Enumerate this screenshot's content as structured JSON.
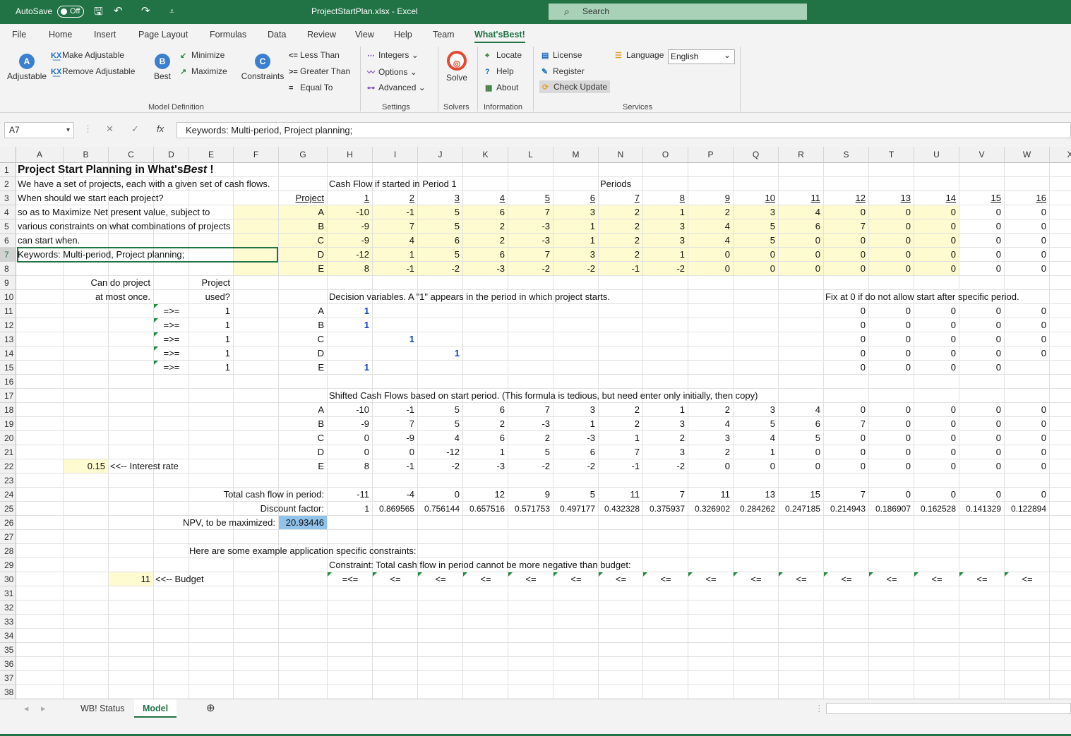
{
  "title": {
    "autosave": "AutoSave",
    "toggle": "Off",
    "file": "ProjectStartPlan.xlsx  -  Excel",
    "search": "Search"
  },
  "menu": [
    "File",
    "Home",
    "Insert",
    "Page Layout",
    "Formulas",
    "Data",
    "Review",
    "View",
    "Help",
    "Team",
    "What'sBest!"
  ],
  "ribbon": {
    "adjustable": "Adjustable",
    "make_adj": "Make Adjustable",
    "remove_adj": "Remove Adjustable",
    "best": "Best",
    "minimize": "Minimize",
    "maximize": "Maximize",
    "constraints": "Constraints",
    "less": "Less Than",
    "greater": "Greater Than",
    "equal": "Equal To",
    "integers": "Integers",
    "options": "Options",
    "advanced": "Advanced",
    "solve": "Solve",
    "locate": "Locate",
    "help": "Help",
    "about": "About",
    "license": "License",
    "register": "Register",
    "check": "Check Update",
    "language": "Language",
    "lang_val": "English",
    "g_model": "Model Definition",
    "g_settings": "Settings",
    "g_solvers": "Solvers",
    "g_info": "Information",
    "g_services": "Services"
  },
  "namebox": "A7",
  "formula": "Keywords: Multi-period, Project planning;",
  "columns": [
    "A",
    "B",
    "C",
    "D",
    "E",
    "F",
    "G",
    "H",
    "I",
    "J",
    "K",
    "L",
    "M",
    "N",
    "O",
    "P",
    "Q",
    "R",
    "S",
    "T",
    "U",
    "V",
    "W",
    "X"
  ],
  "rows": [
    "1",
    "2",
    "3",
    "4",
    "5",
    "6",
    "7",
    "8",
    "9",
    "10",
    "11",
    "12",
    "13",
    "14",
    "15",
    "16",
    "17",
    "18",
    "19",
    "20",
    "21",
    "22",
    "23",
    "24",
    "25",
    "26",
    "27",
    "28",
    "29",
    "30",
    "31",
    "32",
    "33",
    "34",
    "35",
    "36",
    "37",
    "38"
  ],
  "text": {
    "r1": "Project Start Planning in What's",
    "r1b": "Best",
    "r1c": " !",
    "r2": "We have a set of projects, each with a given set of cash flows.",
    "r3": "When should we start each project?",
    "r4": "so as to Maximize Net present value,  subject to",
    "r5": "various constraints on what combinations of projects",
    "r6": "can start when.",
    "r7": "Keywords: Multi-period, Project planning;",
    "cf_hdr": "Cash Flow if started in Period 1",
    "periods": "Periods",
    "project": "Project",
    "can_do": "Can do project",
    "at_most": "at most once.",
    "proj": "Project",
    "used": "used?",
    "dec_vars": "Decision variables.  A \"1\" appears in the period in which project starts.",
    "fix0": "Fix at 0 if do not allow start after specific period.",
    "shifted": "Shifted Cash Flows based on start period. (This formula is tedious, but need enter only initially, then copy)",
    "interest": "<<-- Interest rate",
    "interest_val": "0.15",
    "total_cf": "Total cash flow in period:",
    "discount": "Discount factor:",
    "npv": "NPV, to be maximized:",
    "npv_val": "20.93446",
    "example": "Here are some example application specific constraints:",
    "constraint": "Constraint: Total cash flow in period cannot be more negative than budget:",
    "budget_val": "11",
    "budget": "<<-- Budget"
  },
  "projects": [
    "A",
    "B",
    "C",
    "D",
    "E"
  ],
  "period_nums": [
    "1",
    "2",
    "3",
    "4",
    "5",
    "6",
    "7",
    "8",
    "9",
    "10",
    "11",
    "12",
    "13",
    "14",
    "15",
    "16"
  ],
  "cashflows": [
    [
      "-10",
      "-1",
      "5",
      "6",
      "7",
      "3",
      "2",
      "1",
      "2",
      "3",
      "4",
      "0",
      "0",
      "0",
      "0",
      "0"
    ],
    [
      "-9",
      "7",
      "5",
      "2",
      "-3",
      "1",
      "2",
      "3",
      "4",
      "5",
      "6",
      "7",
      "0",
      "0",
      "0",
      "0"
    ],
    [
      "-9",
      "4",
      "6",
      "2",
      "-3",
      "1",
      "2",
      "3",
      "4",
      "5",
      "0",
      "0",
      "0",
      "0",
      "0",
      "0"
    ],
    [
      "-12",
      "1",
      "5",
      "6",
      "7",
      "3",
      "2",
      "1",
      "0",
      "0",
      "0",
      "0",
      "0",
      "0",
      "0",
      "0"
    ],
    [
      "8",
      "-1",
      "-2",
      "-3",
      "-2",
      "-2",
      "-1",
      "-2",
      "0",
      "0",
      "0",
      "0",
      "0",
      "0",
      "0",
      "0"
    ]
  ],
  "used_op": "=>=",
  "used_vals": [
    "1",
    "1",
    "1",
    "1",
    "1"
  ],
  "decisions": [
    [
      "1"
    ],
    [
      "1"
    ],
    [
      "",
      "1"
    ],
    [
      "",
      "",
      "1"
    ],
    [
      "1"
    ]
  ],
  "fix_vals": [
    [
      "0",
      "0",
      "0",
      "0",
      "0"
    ],
    [
      "0",
      "0",
      "0",
      "0",
      "0"
    ],
    [
      "0",
      "0",
      "0",
      "0",
      "0"
    ],
    [
      "0",
      "0",
      "0",
      "0",
      "0"
    ],
    [
      "0",
      "0",
      "0",
      "0"
    ]
  ],
  "shifted": [
    [
      "-10",
      "-1",
      "5",
      "6",
      "7",
      "3",
      "2",
      "1",
      "2",
      "3",
      "4",
      "0",
      "0",
      "0",
      "0",
      "0"
    ],
    [
      "-9",
      "7",
      "5",
      "2",
      "-3",
      "1",
      "2",
      "3",
      "4",
      "5",
      "6",
      "7",
      "0",
      "0",
      "0",
      "0"
    ],
    [
      "0",
      "-9",
      "4",
      "6",
      "2",
      "-3",
      "1",
      "2",
      "3",
      "4",
      "5",
      "0",
      "0",
      "0",
      "0",
      "0"
    ],
    [
      "0",
      "0",
      "-12",
      "1",
      "5",
      "6",
      "7",
      "3",
      "2",
      "1",
      "0",
      "0",
      "0",
      "0",
      "0",
      "0"
    ],
    [
      "8",
      "-1",
      "-2",
      "-3",
      "-2",
      "-2",
      "-1",
      "-2",
      "0",
      "0",
      "0",
      "0",
      "0",
      "0",
      "0",
      "0"
    ]
  ],
  "totals": [
    "-11",
    "-4",
    "0",
    "12",
    "9",
    "5",
    "11",
    "7",
    "11",
    "13",
    "15",
    "7",
    "0",
    "0",
    "0",
    "0"
  ],
  "discounts": [
    "1",
    "0.869565",
    "0.756144",
    "0.657516",
    "0.571753",
    "0.497177",
    "0.432328",
    "0.375937",
    "0.326902",
    "0.284262",
    "0.247185",
    "0.214943",
    "0.186907",
    "0.162528",
    "0.141329",
    "0.122894"
  ],
  "budget_ops": [
    "=<=",
    "<=",
    "<=",
    "<=",
    "<=",
    "<=",
    "<=",
    "<=",
    "<=",
    "<=",
    "<=",
    "<=",
    "<=",
    "<=",
    "<=",
    "<="
  ],
  "sheets": [
    "WB! Status",
    "Model"
  ]
}
